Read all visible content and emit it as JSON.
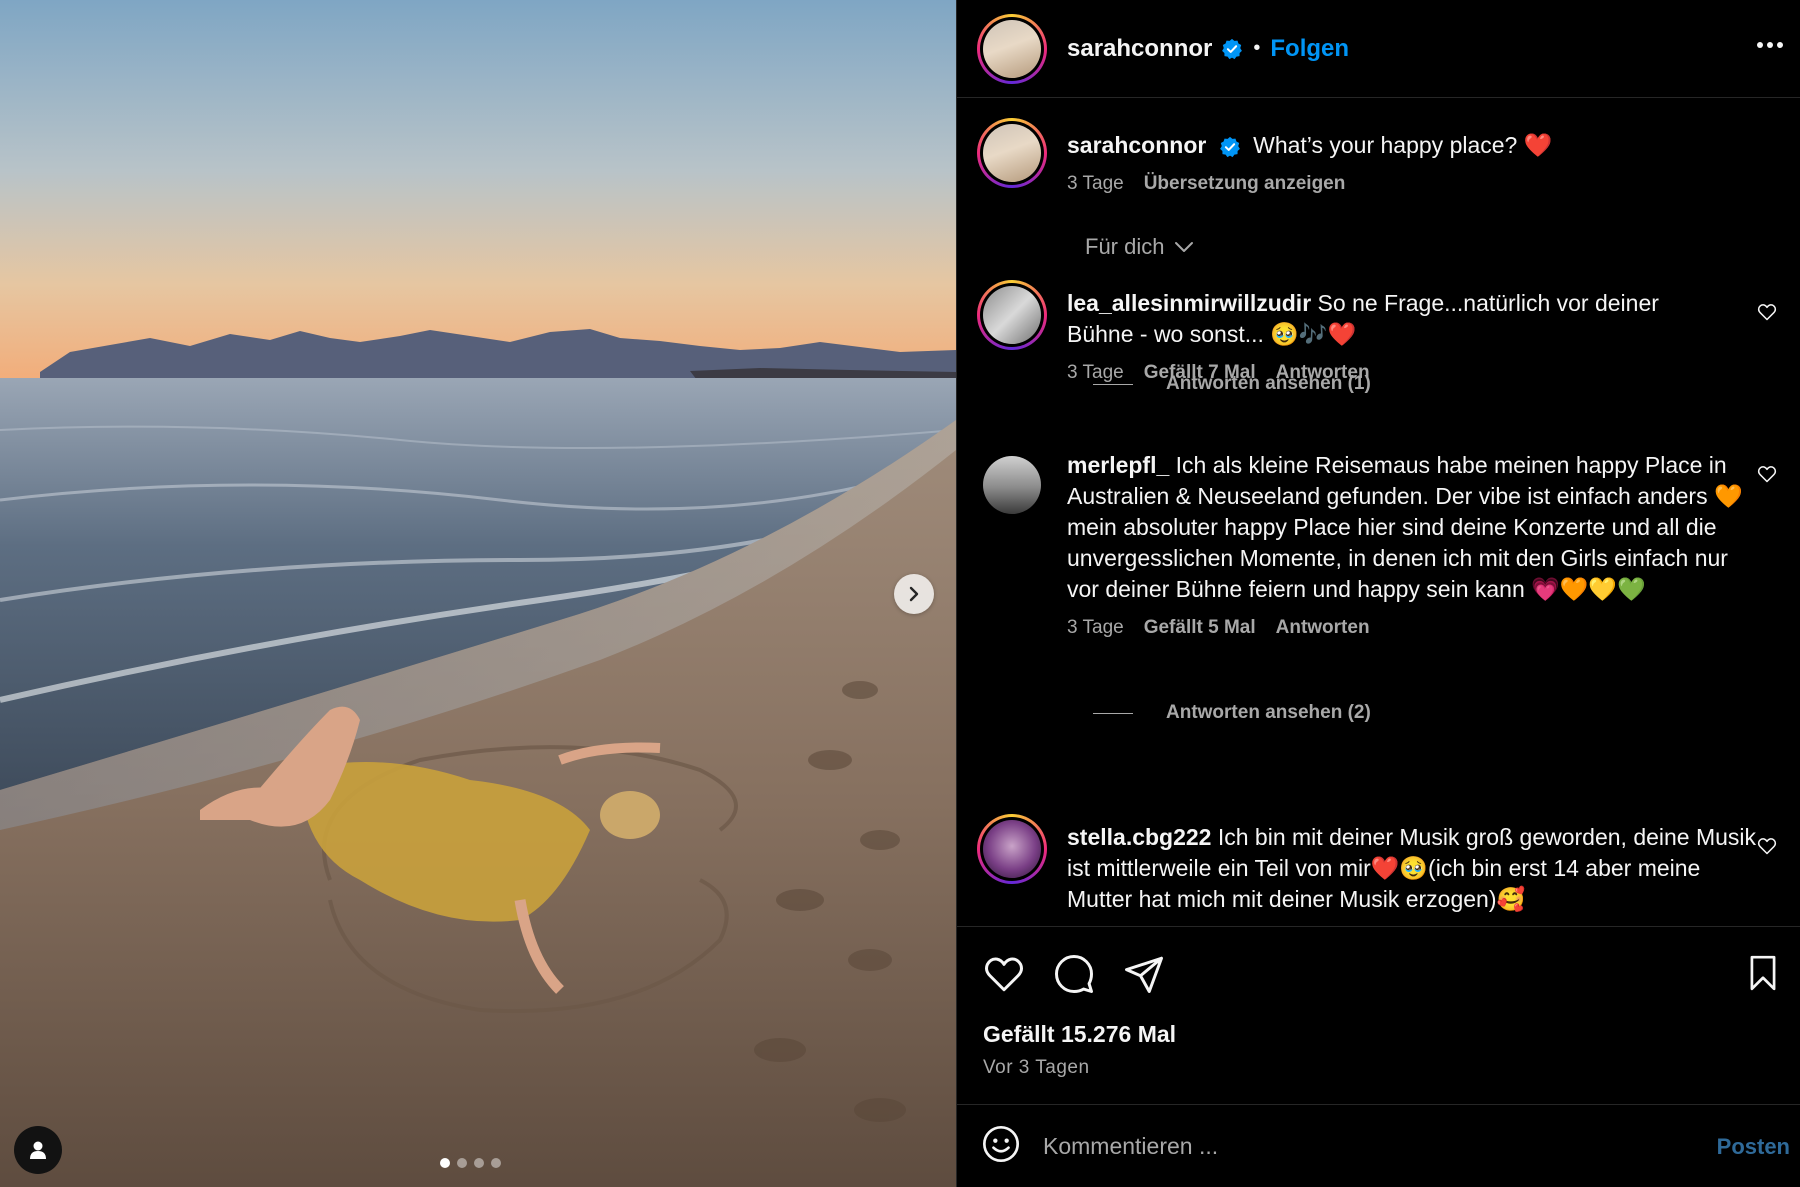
{
  "post": {
    "username": "sarahconnor",
    "dot": "•",
    "follow_label": "Folgen",
    "more_icon": "more-horizontal-icon"
  },
  "caption": {
    "username": "sarahconnor",
    "text": "What’s your happy place? ❤️",
    "age": "3 Tage",
    "translate": "Übersetzung anzeigen"
  },
  "filter": {
    "label": "Für dich"
  },
  "comments": [
    {
      "username": "lea_allesinmirwillzudir",
      "text": "So ne Frage...natürlich vor deiner Bühne - wo sonst... 🥹🎶❤️",
      "age": "3 Tage",
      "likes": "Gefällt 7 Mal",
      "reply": "Antworten",
      "view_replies": "Antworten ansehen (1)"
    },
    {
      "username": "merlepfl_",
      "text": "Ich als kleine Reisemaus habe meinen happy Place in Australien & Neuseeland gefunden. Der vibe ist einfach anders 🧡 mein absoluter happy Place hier sind deine Konzerte und all die unvergesslichen Momente, in denen ich mit den Girls einfach nur vor deiner Bühne feiern und happy sein kann 💗🧡💛💚",
      "age": "3 Tage",
      "likes": "Gefällt 5 Mal",
      "reply": "Antworten",
      "view_replies": "Antworten ansehen (2)"
    },
    {
      "username": "stella.cbg222",
      "text": "Ich bin mit deiner Musik groß geworden, deine Musik ist mittlerweile ein Teil von mir❤️🥹(ich bin erst 14 aber meine Mutter hat mich mit deiner Musik erzogen)🥰"
    }
  ],
  "actions": {
    "likes": "Gefällt 15.276 Mal",
    "date": "Vor 3 Tagen"
  },
  "composer": {
    "placeholder": "Kommentieren ...",
    "post_label": "Posten"
  },
  "carousel": {
    "slides": 4,
    "active": 1
  },
  "colors": {
    "background": "#000000",
    "text": "#f5f5f5",
    "secondary": "#a8a8a8",
    "link_blue": "#0095f6",
    "verified_blue": "#0095f6",
    "divider": "#262626"
  }
}
